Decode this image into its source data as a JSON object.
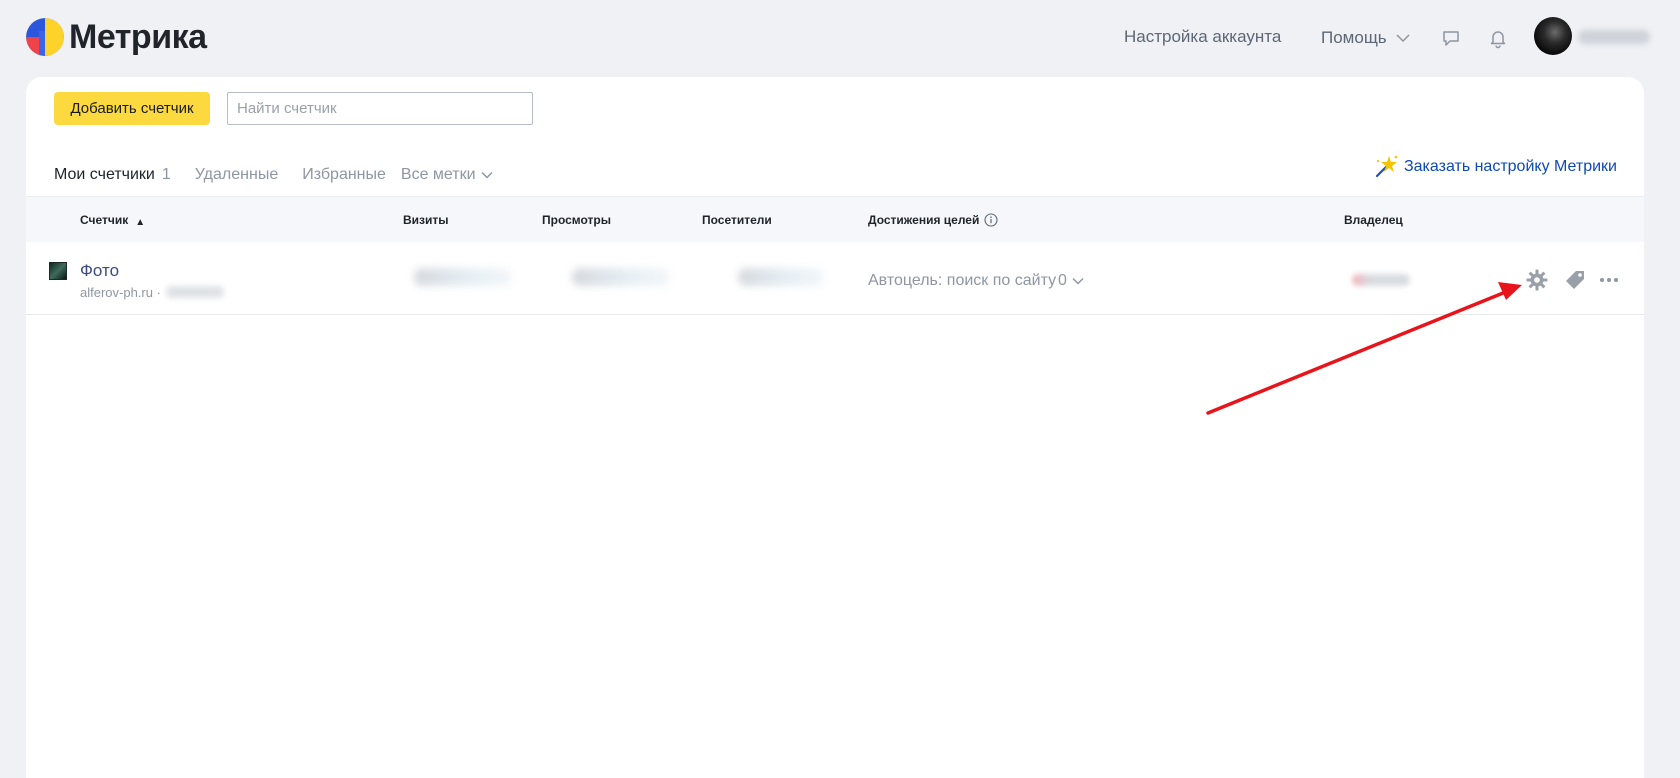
{
  "app": {
    "logo_text": "Метрика"
  },
  "header": {
    "account_settings": "Настройка аккаунта",
    "help": "Помощь"
  },
  "toolbar": {
    "add_counter_label": "Добавить счетчик",
    "search_placeholder": "Найти счетчик",
    "search_value": ""
  },
  "tabs": [
    {
      "label": "Мои счетчики",
      "count": "1",
      "active": true
    },
    {
      "label": "Удаленные"
    },
    {
      "label": "Избранные"
    },
    {
      "label": "Все метки"
    }
  ],
  "order_link": "Заказать настройку Метрики",
  "table": {
    "columns": [
      "Счетчик",
      "Визиты",
      "Просмотры",
      "Посетители",
      "Достижения целей",
      "Владелец"
    ],
    "sort_indicator": "▲",
    "rows": [
      {
        "name": "Фото",
        "site": "alferov-ph.ru ·",
        "goal": "Автоцель: поиск по сайту",
        "goal_count": "0"
      }
    ]
  },
  "icons": {
    "settings": "gear-icon",
    "tag": "tag-icon",
    "more": "more-icon",
    "chat": "chat-icon",
    "bell": "bell-icon",
    "info": "info-icon",
    "wand": "magic-wand-icon"
  },
  "colors": {
    "accent_yellow": "#fcd93f",
    "link_blue": "#0e49b5",
    "tab_underline": "#e8202c",
    "annotation_arrow": "#e8141c"
  }
}
